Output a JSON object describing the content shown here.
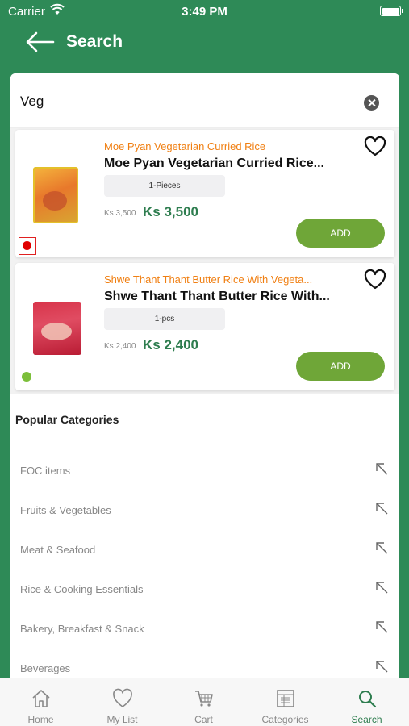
{
  "status_bar": {
    "carrier": "Carrier",
    "time": "3:49 PM"
  },
  "header": {
    "title": "Search"
  },
  "search": {
    "value": "Veg"
  },
  "products": [
    {
      "brand": "Moe Pyan Vegetarian Curried Rice",
      "name": "Moe Pyan Vegetarian Curried Rice...",
      "unit": "1-Pieces",
      "old_price": "Ks 3,500",
      "price": "Ks 3,500",
      "add_label": "ADD",
      "diet_indicator": "red"
    },
    {
      "brand": "Shwe Thant Thant Butter Rice With Vegeta...",
      "name": "Shwe Thant Thant Butter Rice With...",
      "unit": "1-pcs",
      "old_price": "Ks 2,400",
      "price": "Ks 2,400",
      "add_label": "ADD",
      "diet_indicator": "green"
    }
  ],
  "categories": {
    "heading": "Popular Categories",
    "items": [
      "FOC items",
      "Fruits & Vegetables",
      "Meat & Seafood",
      "Rice & Cooking Essentials",
      "Bakery, Breakfast & Snack",
      "Beverages"
    ]
  },
  "tabs": [
    {
      "label": "Home",
      "icon": "home-icon"
    },
    {
      "label": "My List",
      "icon": "heart-icon"
    },
    {
      "label": "Cart",
      "icon": "cart-icon"
    },
    {
      "label": "Categories",
      "icon": "categories-icon"
    },
    {
      "label": "Search",
      "icon": "search-icon",
      "active": true
    }
  ],
  "colors": {
    "header_green": "#2e8a57",
    "price_green": "#2e7d4f",
    "brand_orange": "#f07f12",
    "add_button": "#6fa638"
  }
}
